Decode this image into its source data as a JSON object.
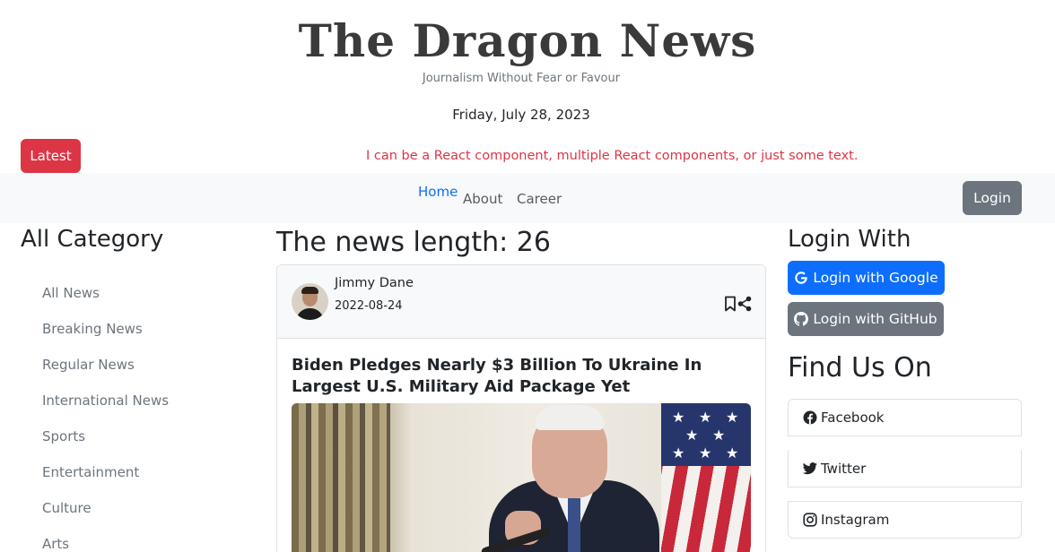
{
  "header": {
    "logo": "The Dragon News",
    "tagline": "Journalism Without Fear or Favour",
    "date": "Friday, July 28, 2023"
  },
  "marquee": {
    "latest_label": "Latest",
    "text": "I can be a React component, multiple React components, or just some text."
  },
  "nav": {
    "home": "Home",
    "about": "About",
    "career": "Career",
    "login": "Login"
  },
  "sidebar": {
    "title": "All Category",
    "items": [
      "All News",
      "Breaking News",
      "Regular News",
      "International News",
      "Sports",
      "Entertainment",
      "Culture",
      "Arts"
    ]
  },
  "main": {
    "news_length": "The news length: 26",
    "card": {
      "author": "Jimmy Dane",
      "published": "2022-08-24",
      "title": "Biden Pledges Nearly $3 Billion To Ukraine In Largest U.S. Military Aid Package Yet"
    }
  },
  "right": {
    "login_title": "Login With",
    "google_label": "Login with Google",
    "github_label": "Login with GitHub",
    "find_title": "Find Us On",
    "social": {
      "facebook": "Facebook",
      "twitter": "Twitter",
      "instagram": "Instagram"
    }
  },
  "colors": {
    "primary": "#0d6efd",
    "danger": "#dc3545",
    "secondary": "#6c757d",
    "navbar_bg": "#f8f9fa"
  }
}
